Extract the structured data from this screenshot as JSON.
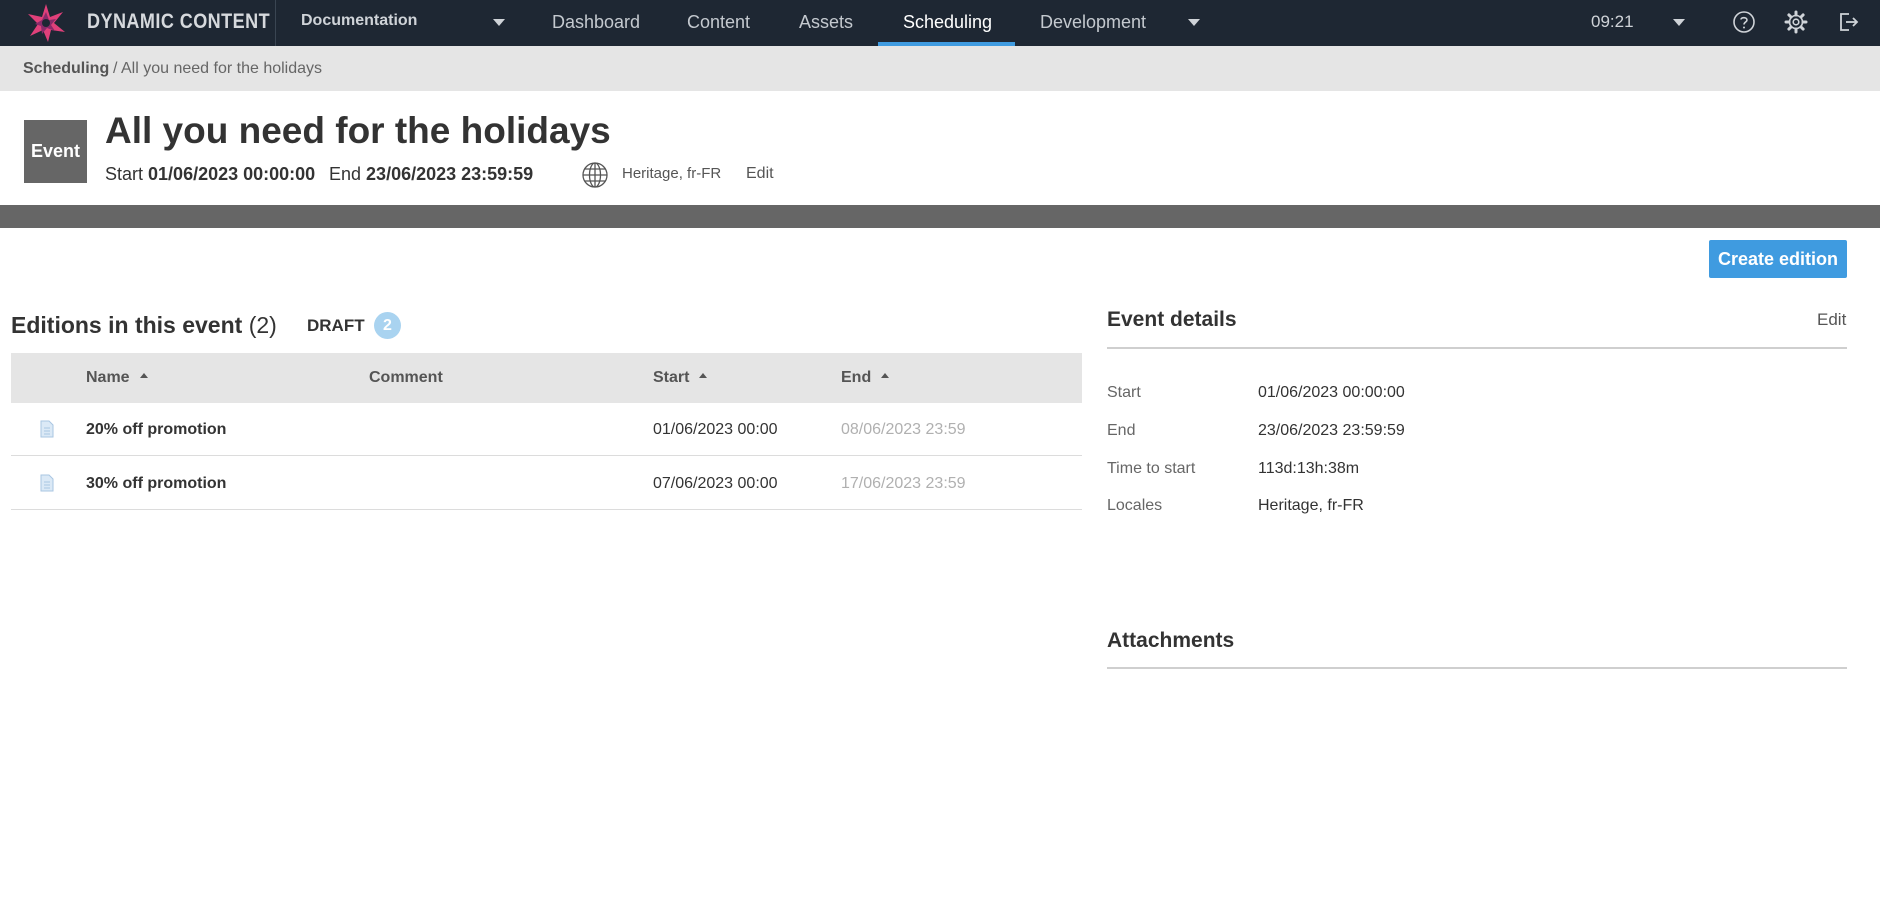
{
  "topbar": {
    "brand": "DYNAMIC CONTENT",
    "hub": "Documentation",
    "nav": [
      "Dashboard",
      "Content",
      "Assets",
      "Scheduling",
      "Development"
    ],
    "active_nav": "Scheduling",
    "clock": "09:21",
    "icons": [
      "chevron-down-icon",
      "help-icon",
      "gear-icon",
      "logout-icon"
    ]
  },
  "breadcrumb": {
    "root": "Scheduling",
    "current": "/ All you need for the holidays"
  },
  "event": {
    "tag": "Event",
    "title": "All you need for the holidays",
    "start_label": "Start",
    "start_value": "01/06/2023 00:00:00",
    "end_label": "End",
    "end_value": "23/06/2023 23:59:59",
    "locales": "Heritage, fr-FR",
    "edit_label": "Edit"
  },
  "actions": {
    "create_edition": "Create edition"
  },
  "editions": {
    "title": "Editions in this event",
    "count": "(2)",
    "draft_label": "DRAFT",
    "draft_count": "2",
    "columns": [
      "Name",
      "Comment",
      "Start",
      "End"
    ],
    "rows": [
      {
        "name": "20% off promotion",
        "comment": "",
        "start": "01/06/2023 00:00",
        "end": "08/06/2023 23:59"
      },
      {
        "name": "30% off promotion",
        "comment": "",
        "start": "07/06/2023 00:00",
        "end": "17/06/2023 23:59"
      }
    ]
  },
  "details": {
    "title": "Event details",
    "edit_label": "Edit",
    "fields": [
      {
        "label": "Start",
        "value": "01/06/2023 00:00:00"
      },
      {
        "label": "End",
        "value": "23/06/2023 23:59:59"
      },
      {
        "label": "Time to start",
        "value": "113d:13h:38m"
      },
      {
        "label": "Locales",
        "value": "Heritage, fr-FR"
      }
    ]
  },
  "attachments": {
    "title": "Attachments"
  },
  "colors": {
    "topbar": "#1e2733",
    "accent": "#3f9be0",
    "event_tag": "#666666",
    "draft_badge": "#a9d3f0"
  }
}
